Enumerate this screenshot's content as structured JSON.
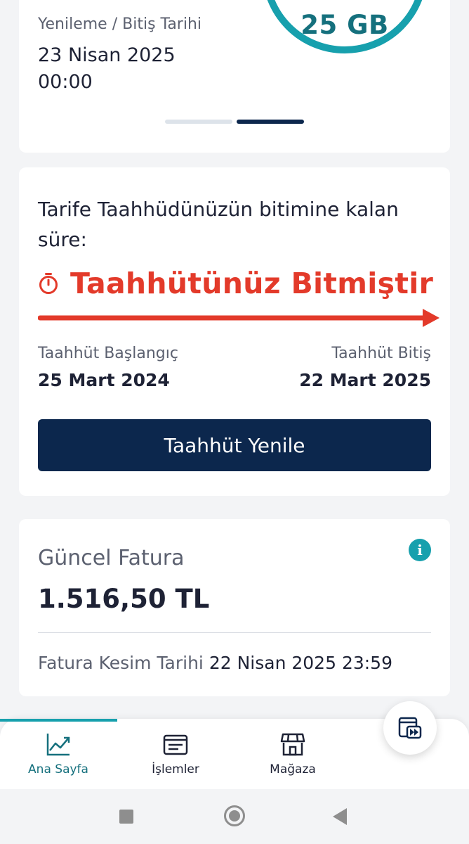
{
  "renewal_card": {
    "label": "Yenileme / Bitiş Tarihi",
    "date": "23 Nisan 2025",
    "time": "00:00",
    "data_remaining": "25 GB",
    "pager_active_index": 1,
    "pager_count": 2
  },
  "commitment_card": {
    "question": "Tarife Taahhüdünüzün bitimine kalan süre:",
    "status": "Taahhütünüz Bitmiştir",
    "status_color": "#e33a2a",
    "start_label": "Taahhüt Başlangıç",
    "start_date": "25 Mart 2024",
    "end_label": "Taahhüt Bitiş",
    "end_date": "22 Mart 2025",
    "button_label": "Taahhüt Yenile"
  },
  "invoice_card": {
    "title": "Güncel Fatura",
    "amount": "1.516,50 TL",
    "cutoff_label": "Fatura Kesim Tarihi",
    "cutoff_value": "22 Nisan 2025 23:59",
    "info_icon": "i"
  },
  "bottom_nav": {
    "items": [
      {
        "label": "Ana Sayfa",
        "icon": "chart-line-icon",
        "active": true
      },
      {
        "label": "İşlemler",
        "icon": "receipt-list-icon",
        "active": false
      },
      {
        "label": "Mağaza",
        "icon": "storefront-icon",
        "active": false
      }
    ],
    "fab_icon": "media-play-icon"
  },
  "system_nav": {
    "buttons": [
      "recents-icon",
      "home-icon",
      "back-icon"
    ]
  },
  "colors": {
    "accent_teal": "#17a0ad",
    "navy": "#0c274d",
    "alert_red": "#e33a2a"
  }
}
